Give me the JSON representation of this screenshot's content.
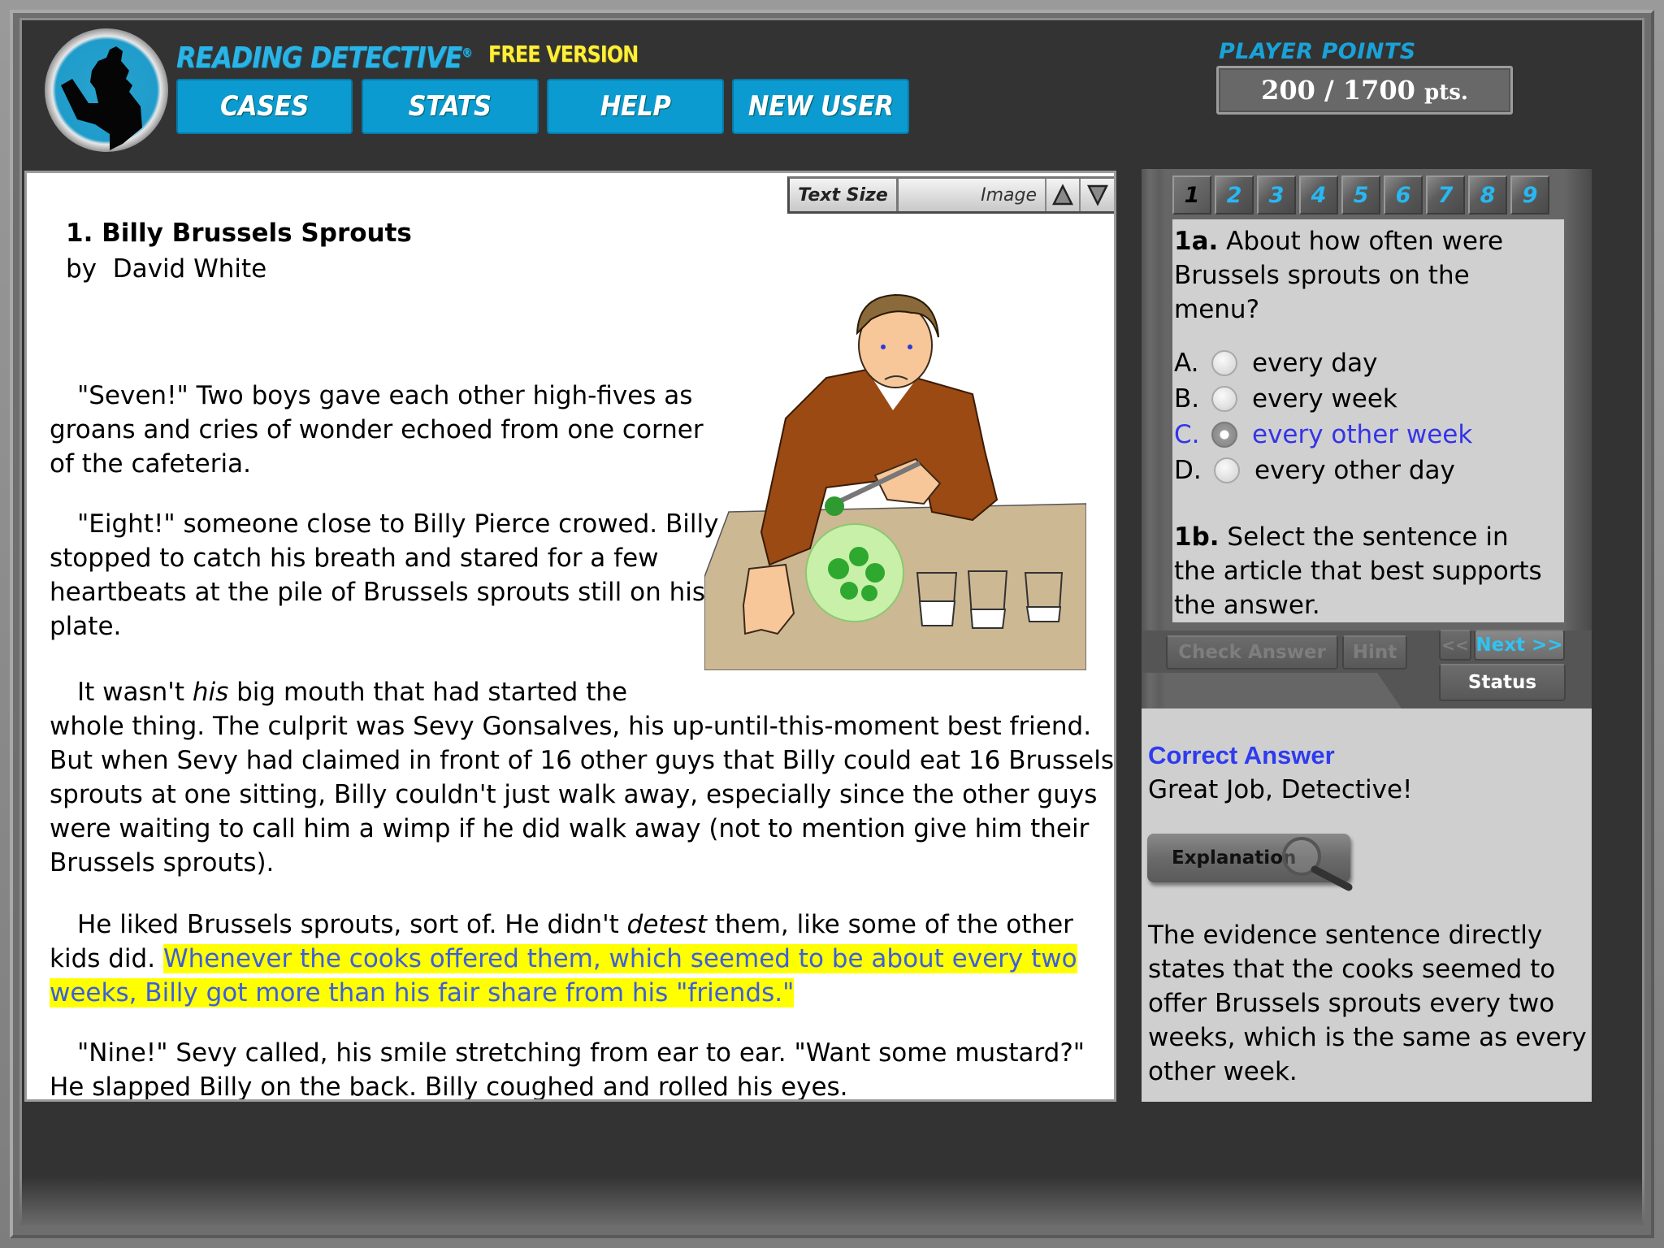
{
  "header": {
    "brand_name": "READING DETECTIVE",
    "brand_reg": "®",
    "brand_edition": "FREE VERSION",
    "nav": [
      {
        "label": "CASES"
      },
      {
        "label": "STATS"
      },
      {
        "label": "HELP"
      },
      {
        "label": "NEW USER"
      }
    ],
    "points_label": "PLAYER POINTS",
    "points_value": "200 / 1700",
    "points_unit": "pts."
  },
  "story": {
    "toolbar": {
      "text_size_label": "Text Size",
      "image_label": "Image",
      "increase_icon": "triangle-up-icon",
      "decrease_icon": "triangle-down-icon"
    },
    "title": "1. Billy Brussels Sprouts",
    "author": "by  David White",
    "illustration_alt": "Boy sitting at a table with a plate of Brussels sprouts and three glasses of milk",
    "paragraphs": [
      {
        "text": "\"Seven!\" Two boys gave each other high-fives as groans and cries of wonder echoed from one corner of the cafeteria."
      },
      {
        "text": "\"Eight!\" someone close to Billy Pierce crowed. Billy stopped to catch his breath and stared for a few heartbeats at the pile of Brussels sprouts still on his plate."
      },
      {
        "before": "It wasn't ",
        "emph": "his",
        "after": " big mouth that had started the",
        "rest": "whole thing. The culprit was Sevy Gonsalves, his up-until-this-moment best friend. But when Sevy had claimed in front of 16 other guys that Billy could eat 16 Brussels sprouts at one sitting, Billy couldn't just walk away, especially since the other guys were waiting to call him a wimp if he did walk away (not to mention give him their Brussels sprouts)."
      },
      {
        "before": "He liked Brussels sprouts, sort of. He didn't ",
        "emph": "detest",
        "after": " them, like some of the other kids did. ",
        "highlight": "Whenever the cooks offered them, which seemed to be about every two weeks, Billy got more than his fair share from his \"friends.\""
      },
      {
        "text": "\"Nine!\" Sevy called, his smile stretching from ear to ear. \"Want some mustard?\" He slapped Billy on the back. Billy coughed and rolled his eyes."
      }
    ],
    "highlight_bg": "#ffff00",
    "highlight_fg": "#3c5fdc"
  },
  "quiz": {
    "question_numbers": [
      "1",
      "2",
      "3",
      "4",
      "5",
      "6",
      "7",
      "8",
      "9"
    ],
    "active_question": "1",
    "q1a_label": "1a.",
    "q1a_text": " About how often were Brussels sprouts on the menu?",
    "options": [
      {
        "letter": "A.",
        "text": "every day",
        "selected": false
      },
      {
        "letter": "B.",
        "text": "every week",
        "selected": false
      },
      {
        "letter": "C.",
        "text": "every other week",
        "selected": true
      },
      {
        "letter": "D.",
        "text": "every other day",
        "selected": false
      }
    ],
    "q1b_label": "1b.",
    "q1b_text": " Select the sentence in the article that best supports the answer.",
    "buttons": {
      "check_answer": "Check Answer",
      "hint": "Hint",
      "prev": "<<",
      "next": "Next >>",
      "status": "Status"
    },
    "selected_color": "#3434e8"
  },
  "feedback": {
    "title": "Correct Answer",
    "message": "Great Job, Detective!",
    "explanation_button": "Explanation",
    "explanation_text": "The evidence sentence directly states that the cooks seemed to offer Brussels sprouts every two weeks, which is the same as every other week."
  },
  "colors": {
    "brand_blue": "#0b9bd0",
    "brand_yellow": "#ffef3a",
    "frame_dark": "#333333",
    "panel_gray": "#d0d0d0",
    "feedback_title": "#2e3bef"
  }
}
